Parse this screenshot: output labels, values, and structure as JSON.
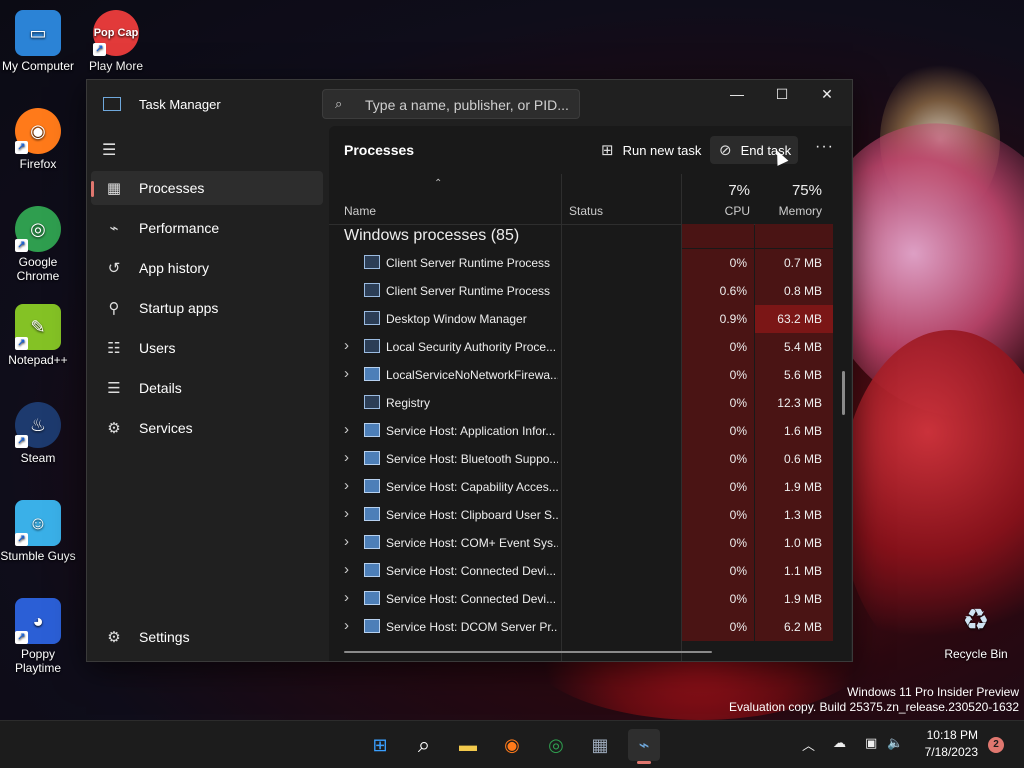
{
  "desktop": {
    "icons": [
      {
        "label": "My Computer",
        "glyph": "▭",
        "color": "#2b83d6"
      },
      {
        "label": "Play More Great Games!",
        "glyph": "Pop Cap",
        "color": "#e23a3a"
      },
      {
        "label": "Firefox",
        "glyph": "◉",
        "color": "#ff7a1a"
      },
      {
        "label": "Google Chrome",
        "glyph": "◎",
        "color": "#2f9e4f"
      },
      {
        "label": "Notepad++",
        "glyph": "✎",
        "color": "#84c225"
      },
      {
        "label": "Steam",
        "glyph": "♨",
        "color": "#1d3a6e"
      },
      {
        "label": "Stumble Guys",
        "glyph": "☺",
        "color": "#3ab0e8"
      },
      {
        "label": "Poppy Playtime",
        "glyph": "◕",
        "color": "#2b5fd6"
      },
      {
        "label": "Recycle Bin",
        "glyph": "♻",
        "color": "#cfe3f2"
      }
    ],
    "watermark": {
      "line1": "Windows 11 Pro Insider Preview",
      "line2": "Evaluation copy. Build 25375.zn_release.230520-1632"
    }
  },
  "window": {
    "title": "Task Manager",
    "search_placeholder": "Type a name, publisher, or PID...",
    "controls": {
      "minimize": "—",
      "maximize": "☐",
      "close": "✕"
    }
  },
  "sidebar": {
    "menu_icon": "hamburger-icon",
    "items": [
      {
        "label": "Processes",
        "icon": "▦",
        "active": true
      },
      {
        "label": "Performance",
        "icon": "⌁",
        "active": false
      },
      {
        "label": "App history",
        "icon": "↺",
        "active": false
      },
      {
        "label": "Startup apps",
        "icon": "⚲",
        "active": false
      },
      {
        "label": "Users",
        "icon": "☷",
        "active": false
      },
      {
        "label": "Details",
        "icon": "☰",
        "active": false
      },
      {
        "label": "Services",
        "icon": "⚙",
        "active": false
      }
    ],
    "settings_label": "Settings"
  },
  "toolbar": {
    "page_title": "Processes",
    "run_new_task": "Run new task",
    "end_task": "End task",
    "more": "···"
  },
  "table": {
    "columns": {
      "name": "Name",
      "status": "Status",
      "cpu": "CPU",
      "memory": "Memory",
      "cpu_total": "7%",
      "memory_total": "75%"
    },
    "group_title": "Windows processes (85)",
    "rows": [
      {
        "name": "Client Server Runtime Process",
        "expandable": false,
        "type": "app",
        "cpu": "0%",
        "memory": "0.7 MB",
        "hot": false
      },
      {
        "name": "Client Server Runtime Process",
        "expandable": false,
        "type": "app",
        "cpu": "0.6%",
        "memory": "0.8 MB",
        "hot": false
      },
      {
        "name": "Desktop Window Manager",
        "expandable": false,
        "type": "app",
        "cpu": "0.9%",
        "memory": "63.2 MB",
        "hot": true
      },
      {
        "name": "Local Security Authority Proce...",
        "expandable": true,
        "type": "app",
        "cpu": "0%",
        "memory": "5.4 MB",
        "hot": false
      },
      {
        "name": "LocalServiceNoNetworkFirewa...",
        "expandable": true,
        "type": "svc",
        "cpu": "0%",
        "memory": "5.6 MB",
        "hot": false
      },
      {
        "name": "Registry",
        "expandable": false,
        "type": "app",
        "cpu": "0%",
        "memory": "12.3 MB",
        "hot": false
      },
      {
        "name": "Service Host: Application Infor...",
        "expandable": true,
        "type": "svc",
        "cpu": "0%",
        "memory": "1.6 MB",
        "hot": false
      },
      {
        "name": "Service Host: Bluetooth Suppo...",
        "expandable": true,
        "type": "svc",
        "cpu": "0%",
        "memory": "0.6 MB",
        "hot": false
      },
      {
        "name": "Service Host: Capability Acces...",
        "expandable": true,
        "type": "svc",
        "cpu": "0%",
        "memory": "1.9 MB",
        "hot": false
      },
      {
        "name": "Service Host: Clipboard User S...",
        "expandable": true,
        "type": "svc",
        "cpu": "0%",
        "memory": "1.3 MB",
        "hot": false
      },
      {
        "name": "Service Host: COM+ Event Sys...",
        "expandable": true,
        "type": "svc",
        "cpu": "0%",
        "memory": "1.0 MB",
        "hot": false
      },
      {
        "name": "Service Host: Connected Devi...",
        "expandable": true,
        "type": "svc",
        "cpu": "0%",
        "memory": "1.1 MB",
        "hot": false
      },
      {
        "name": "Service Host: Connected Devi...",
        "expandable": true,
        "type": "svc",
        "cpu": "0%",
        "memory": "1.9 MB",
        "hot": false
      },
      {
        "name": "Service Host: DCOM Server Pr...",
        "expandable": true,
        "type": "svc",
        "cpu": "0%",
        "memory": "6.2 MB",
        "hot": false
      }
    ]
  },
  "taskbar": {
    "apps": [
      {
        "name": "start",
        "glyph": "⊞",
        "color": "#3aa0ff",
        "active": false
      },
      {
        "name": "search",
        "glyph": "⌕",
        "color": "#ffffff",
        "active": false
      },
      {
        "name": "file-explorer",
        "glyph": "▬",
        "color": "#f2c94c",
        "active": false
      },
      {
        "name": "firefox",
        "glyph": "◉",
        "color": "#ff7a1a",
        "active": false
      },
      {
        "name": "chrome",
        "glyph": "◎",
        "color": "#2f9e4f",
        "active": false
      },
      {
        "name": "calculator",
        "glyph": "▦",
        "color": "#9aa7b8",
        "active": false
      },
      {
        "name": "task-manager",
        "glyph": "⌁",
        "color": "#6fa8dc",
        "active": true
      }
    ],
    "tray": {
      "chevron": "︿",
      "onedrive": "☁",
      "network": "▣",
      "volume": "🔈"
    },
    "time": "10:18 PM",
    "date": "7/18/2023",
    "notifications": "2"
  },
  "colors": {
    "accent": "#e0776f",
    "heat": "#4a1414",
    "heat_hot": "#7b1616"
  }
}
